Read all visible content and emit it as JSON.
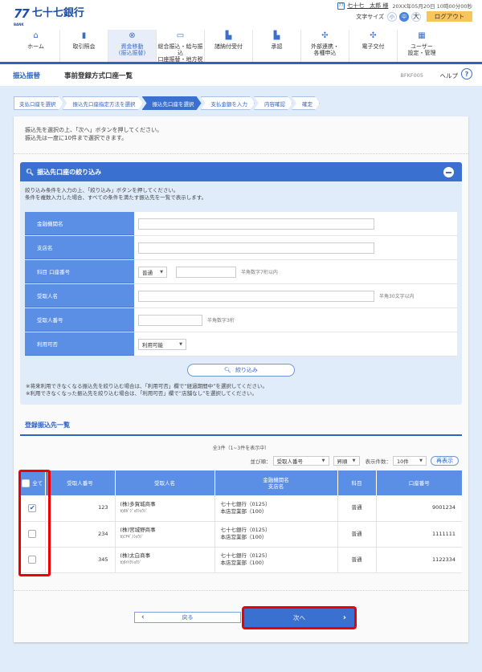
{
  "header": {
    "logo_mark": "77",
    "logo_sub": "BANK",
    "bank_name": "七十七銀行",
    "user_icon": "user-badge-icon",
    "user_name": "七十七　太郎 様",
    "datetime": "20XX年05月20日 10時00分00秒",
    "font_size_label": "文字サイズ",
    "font_sizes": [
      "小",
      "中",
      "大"
    ],
    "font_size_selected": "中",
    "logout_label": "ログアウト"
  },
  "nav": {
    "items": [
      {
        "icon": "home-icon",
        "glyph": "⌂",
        "line1": "ホーム",
        "line2": ""
      },
      {
        "icon": "document-icon",
        "glyph": "▮",
        "line1": "取引照会",
        "line2": ""
      },
      {
        "icon": "yen-transfer-icon",
        "glyph": "⊗",
        "line1": "資金移動",
        "line2": "(振込振替)",
        "active": true
      },
      {
        "icon": "card-icon",
        "glyph": "▭",
        "line1": "総合振込・給与振込",
        "line2": "口座振替・地方税"
      },
      {
        "icon": "payment-icon",
        "glyph": "▙",
        "line1": "諸納付受付",
        "line2": ""
      },
      {
        "icon": "approve-icon",
        "glyph": "▙",
        "line1": "承認",
        "line2": ""
      },
      {
        "icon": "link-icon",
        "glyph": "✣",
        "line1": "外部連携・",
        "line2": "各種申込"
      },
      {
        "icon": "delivery-icon",
        "glyph": "✣",
        "line1": "電子交付",
        "line2": ""
      },
      {
        "icon": "user-manage-icon",
        "glyph": "▦",
        "line1": "ユーザー",
        "line2": "設定・管理"
      }
    ]
  },
  "titlebar": {
    "category": "振込振替",
    "title": "事前登録方式口座一覧",
    "screen_code": "BFKF005",
    "help_label": "ヘルプ",
    "help_icon": "?"
  },
  "steps": [
    {
      "label": "支払口座を選択",
      "active": false
    },
    {
      "label": "振込先口座指定方法を選択",
      "active": false
    },
    {
      "label": "振込先口座を選択",
      "active": true
    },
    {
      "label": "支払金額を入力",
      "active": false
    },
    {
      "label": "内容確認",
      "active": false
    },
    {
      "label": "確定",
      "active": false
    }
  ],
  "intro": {
    "line1": "振込先を選択の上、「次へ」ボタンを押してください。",
    "line2": "振込先は一度に10件まで選択できます。"
  },
  "filter": {
    "title": "振込先口座の絞り込み",
    "desc1": "絞り込み条件を入力の上、「絞り込み」ボタンを押してください。",
    "desc2": "条件を複数入力した場合、すべての条件を満たす振込先を一覧で表示します。",
    "fields": {
      "bank_name": {
        "label": "金融機関名",
        "value": ""
      },
      "branch_name": {
        "label": "支店名",
        "value": ""
      },
      "account": {
        "label": "科目 口座番号",
        "type_value": "普通",
        "number_value": "",
        "hint": "半角数字7桁以内"
      },
      "payee_name": {
        "label": "受取人名",
        "value": "",
        "hint": "半角30文字以内"
      },
      "payee_number": {
        "label": "受取人番号",
        "value": "",
        "hint": "半角数字3桁"
      },
      "availability": {
        "label": "利用可否",
        "value": "利用可能"
      }
    },
    "search_button": "絞り込み",
    "note1": "※将来利用できなくなる振込先を絞り込む場合は、「利用可否」欄で“経過期間中”を選択してください。",
    "note2": "※利用できなくなった振込先を絞り込む場合は、「利用可否」欄で“店舗なし”を選択してください。"
  },
  "list": {
    "title": "登録振込先一覧",
    "count_text": "全3件（1~3件を表示中）",
    "sort_label": "並び順：",
    "sort_value": "受取人番号",
    "order_value": "昇順",
    "per_page_label": "表示件数：",
    "per_page_value": "10件",
    "redisplay_button": "再表示",
    "columns": {
      "all": "全て",
      "payee_number": "受取人番号",
      "payee_name": "受取人名",
      "bank_line1": "金融機関名",
      "bank_line2": "支店名",
      "type": "科目",
      "account_number": "口座番号"
    },
    "rows": [
      {
        "checked": true,
        "payee_number": "123",
        "name": "(株)多賀城商事",
        "kana": "ｶ)ﾀｶﾞｼﾞｮｳｼｮｳｼﾞ",
        "bank": "七十七銀行（0125）",
        "branch": "本店営業部（100）",
        "type": "普通",
        "account": "9001234"
      },
      {
        "checked": false,
        "payee_number": "234",
        "name": "(株)宮城野商事",
        "kana": "ｶ)ﾐﾔｷﾞﾉｼｮｳｼﾞ",
        "bank": "七十七銀行（0125）",
        "branch": "本店営業部（100）",
        "type": "普通",
        "account": "1111111"
      },
      {
        "checked": false,
        "payee_number": "345",
        "name": "(株)太白商事",
        "kana": "ｶ)ﾀｲﾊｸｼｮｳｼﾞ",
        "bank": "七十七銀行（0125）",
        "branch": "本店営業部（100）",
        "type": "普通",
        "account": "1122334"
      }
    ]
  },
  "footer": {
    "back_button": "戻る",
    "next_button": "次へ"
  }
}
